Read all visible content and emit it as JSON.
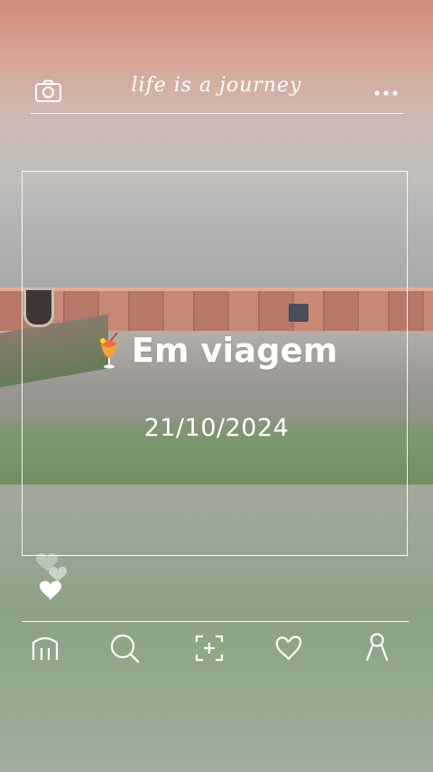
{
  "header": {
    "title": "life is a journey",
    "left_icon": "camera-icon",
    "right_icon": "more-dots-icon"
  },
  "post": {
    "caption": "Em viagem",
    "caption_emoji": "tropical-drink-emoji",
    "date": "21/10/2024"
  },
  "reactions": {
    "icon": "floating-hearts-icon"
  },
  "bottom_nav": {
    "items": [
      {
        "icon": "home-icon"
      },
      {
        "icon": "search-icon"
      },
      {
        "icon": "add-scan-icon"
      },
      {
        "icon": "heart-icon"
      },
      {
        "icon": "profile-icon"
      }
    ]
  },
  "colors": {
    "foreground": "#ffffff",
    "top_background": "#c97f6a",
    "bottom_background": "#8f9d89"
  }
}
